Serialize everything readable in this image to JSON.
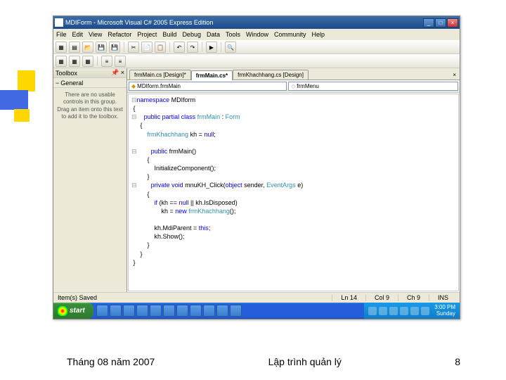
{
  "slide": {
    "date": "Tháng 08 năm 2007",
    "title": "Lập trình quản lý",
    "page": "8"
  },
  "window": {
    "title": "MDIForm - Microsoft Visual C# 2005 Express Edition",
    "min": "_",
    "max": "□",
    "close": "×"
  },
  "menu": [
    "File",
    "Edit",
    "View",
    "Refactor",
    "Project",
    "Build",
    "Debug",
    "Data",
    "Tools",
    "Window",
    "Community",
    "Help"
  ],
  "toolbox": {
    "header": "Toolbox",
    "pin": "📌",
    "close": "×",
    "group_expander": "−",
    "group": "General",
    "message": "There are no usable controls in this group. Drag an item onto this text to add it to the toolbox."
  },
  "tabs": {
    "t1": "frmMain.cs [Design]*",
    "t2": "frmMain.cs*",
    "t3": "frmKhachhang.cs [Design]",
    "close": "×"
  },
  "nav": {
    "left_icon": "◆",
    "left": "MDIform.frmMain",
    "right_icon": "◇",
    "right": "frmMenu"
  },
  "code": {
    "l1": "namespace MDIform",
    "l2": "{",
    "l3": "    public partial class frmMain : Form",
    "l4": "    {",
    "l5": "        frmKhachhang kh = null;",
    "l6": "",
    "l7": "        public frmMain()",
    "l8": "        {",
    "l9": "            InitializeComponent();",
    "l10": "        }",
    "l11": "        private void mnuKH_Click(object sender, EventArgs e)",
    "l12": "        {",
    "l13": "            if (kh == null || kh.IsDisposed)",
    "l14": "                kh = new frmKhachhang();",
    "l15": "",
    "l16": "            kh.MdiParent = this;",
    "l17": "            kh.Show();",
    "l18": "        }",
    "l19": "    }",
    "l20": "}"
  },
  "status": {
    "msg": "Item(s) Saved",
    "ln": "Ln 14",
    "col": "Col 9",
    "ch": "Ch 9",
    "ins": "INS"
  },
  "taskbar": {
    "start": "start",
    "time": "3:00 PM",
    "day": "Sunday"
  }
}
